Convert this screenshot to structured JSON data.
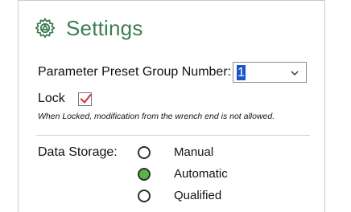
{
  "header": {
    "title": "Settings",
    "icon": "gear-icon"
  },
  "preset": {
    "label": "Parameter Preset Group Number:",
    "value": "1"
  },
  "lock": {
    "label": "Lock",
    "checked": true,
    "note": "When Locked, modification from the wrench end is not allowed."
  },
  "storage": {
    "label": "Data Storage:",
    "options": [
      {
        "label": "Manual",
        "selected": false
      },
      {
        "label": "Automatic",
        "selected": true
      },
      {
        "label": "Qualified",
        "selected": false
      }
    ]
  },
  "colors": {
    "title": "#3d7d54",
    "selected_radio": "#58b447",
    "checkmark": "#d23b3b",
    "select_highlight": "#1a56c9"
  }
}
